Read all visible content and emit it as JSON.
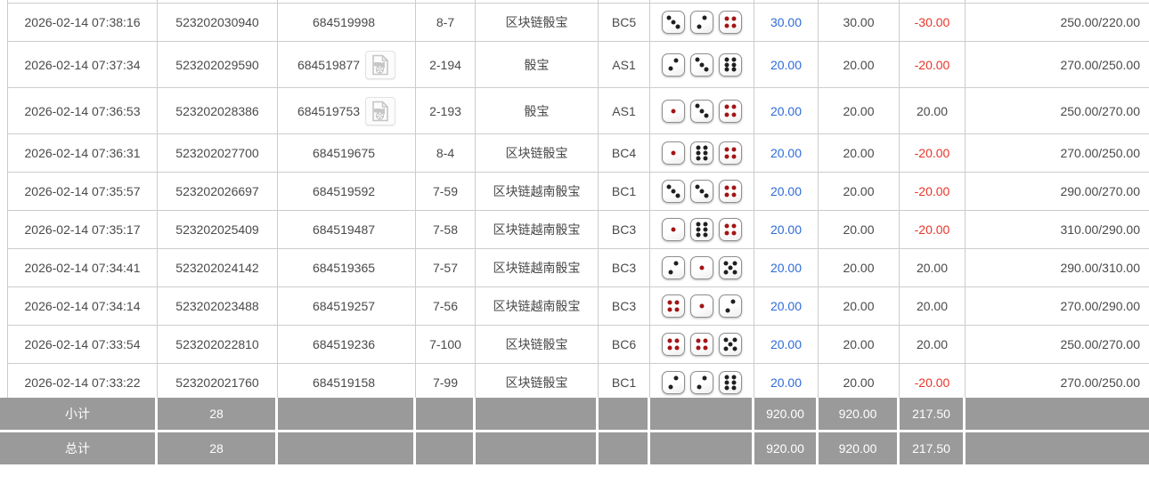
{
  "colors": {
    "accent_blue": "#2e6bd8",
    "negative_red": "#e8352a",
    "summary_gray": "#9a9a9a",
    "border_gray": "#cccccc",
    "dice_red_pip": "#a31414",
    "dice_black_pip": "#1f1f1f"
  },
  "table": {
    "rows": [
      {
        "time": "2026-02-14 07:38:16",
        "order_no": "523202030940",
        "round_no": "684519998",
        "has_video": false,
        "period": "8-7",
        "game": "区块链骰宝",
        "table_code": "BC5",
        "dice": [
          3,
          2,
          4
        ],
        "bet_amount": "30.00",
        "valid_bet": "30.00",
        "win_loss": "-30.00",
        "balance": "250.00/220.00"
      },
      {
        "time": "2026-02-14 07:37:34",
        "order_no": "523202029590",
        "round_no": "684519877",
        "has_video": true,
        "period": "2-194",
        "game": "骰宝",
        "table_code": "AS1",
        "dice": [
          2,
          3,
          6
        ],
        "bet_amount": "20.00",
        "valid_bet": "20.00",
        "win_loss": "-20.00",
        "balance": "270.00/250.00"
      },
      {
        "time": "2026-02-14 07:36:53",
        "order_no": "523202028386",
        "round_no": "684519753",
        "has_video": true,
        "period": "2-193",
        "game": "骰宝",
        "table_code": "AS1",
        "dice": [
          1,
          3,
          4
        ],
        "bet_amount": "20.00",
        "valid_bet": "20.00",
        "win_loss": "20.00",
        "balance": "250.00/270.00"
      },
      {
        "time": "2026-02-14 07:36:31",
        "order_no": "523202027700",
        "round_no": "684519675",
        "has_video": false,
        "period": "8-4",
        "game": "区块链骰宝",
        "table_code": "BC4",
        "dice": [
          1,
          6,
          4
        ],
        "bet_amount": "20.00",
        "valid_bet": "20.00",
        "win_loss": "-20.00",
        "balance": "270.00/250.00"
      },
      {
        "time": "2026-02-14 07:35:57",
        "order_no": "523202026697",
        "round_no": "684519592",
        "has_video": false,
        "period": "7-59",
        "game": "区块链越南骰宝",
        "table_code": "BC1",
        "dice": [
          3,
          3,
          4
        ],
        "bet_amount": "20.00",
        "valid_bet": "20.00",
        "win_loss": "-20.00",
        "balance": "290.00/270.00"
      },
      {
        "time": "2026-02-14 07:35:17",
        "order_no": "523202025409",
        "round_no": "684519487",
        "has_video": false,
        "period": "7-58",
        "game": "区块链越南骰宝",
        "table_code": "BC3",
        "dice": [
          1,
          6,
          4
        ],
        "bet_amount": "20.00",
        "valid_bet": "20.00",
        "win_loss": "-20.00",
        "balance": "310.00/290.00"
      },
      {
        "time": "2026-02-14 07:34:41",
        "order_no": "523202024142",
        "round_no": "684519365",
        "has_video": false,
        "period": "7-57",
        "game": "区块链越南骰宝",
        "table_code": "BC3",
        "dice": [
          2,
          1,
          5
        ],
        "bet_amount": "20.00",
        "valid_bet": "20.00",
        "win_loss": "20.00",
        "balance": "290.00/310.00"
      },
      {
        "time": "2026-02-14 07:34:14",
        "order_no": "523202023488",
        "round_no": "684519257",
        "has_video": false,
        "period": "7-56",
        "game": "区块链越南骰宝",
        "table_code": "BC3",
        "dice": [
          4,
          1,
          2
        ],
        "bet_amount": "20.00",
        "valid_bet": "20.00",
        "win_loss": "20.00",
        "balance": "270.00/290.00"
      },
      {
        "time": "2026-02-14 07:33:54",
        "order_no": "523202022810",
        "round_no": "684519236",
        "has_video": false,
        "period": "7-100",
        "game": "区块链骰宝",
        "table_code": "BC6",
        "dice": [
          4,
          4,
          5
        ],
        "bet_amount": "20.00",
        "valid_bet": "20.00",
        "win_loss": "20.00",
        "balance": "250.00/270.00"
      },
      {
        "time": "2026-02-14 07:33:22",
        "order_no": "523202021760",
        "round_no": "684519158",
        "has_video": false,
        "period": "7-99",
        "game": "区块链骰宝",
        "table_code": "BC1",
        "dice": [
          2,
          2,
          6
        ],
        "bet_amount": "20.00",
        "valid_bet": "20.00",
        "win_loss": "-20.00",
        "balance": "270.00/250.00"
      }
    ],
    "summary": [
      {
        "label": "小计",
        "count": "28",
        "bet_amount": "920.00",
        "valid_bet": "920.00",
        "win_loss": "217.50"
      },
      {
        "label": "总计",
        "count": "28",
        "bet_amount": "920.00",
        "valid_bet": "920.00",
        "win_loss": "217.50"
      }
    ]
  }
}
